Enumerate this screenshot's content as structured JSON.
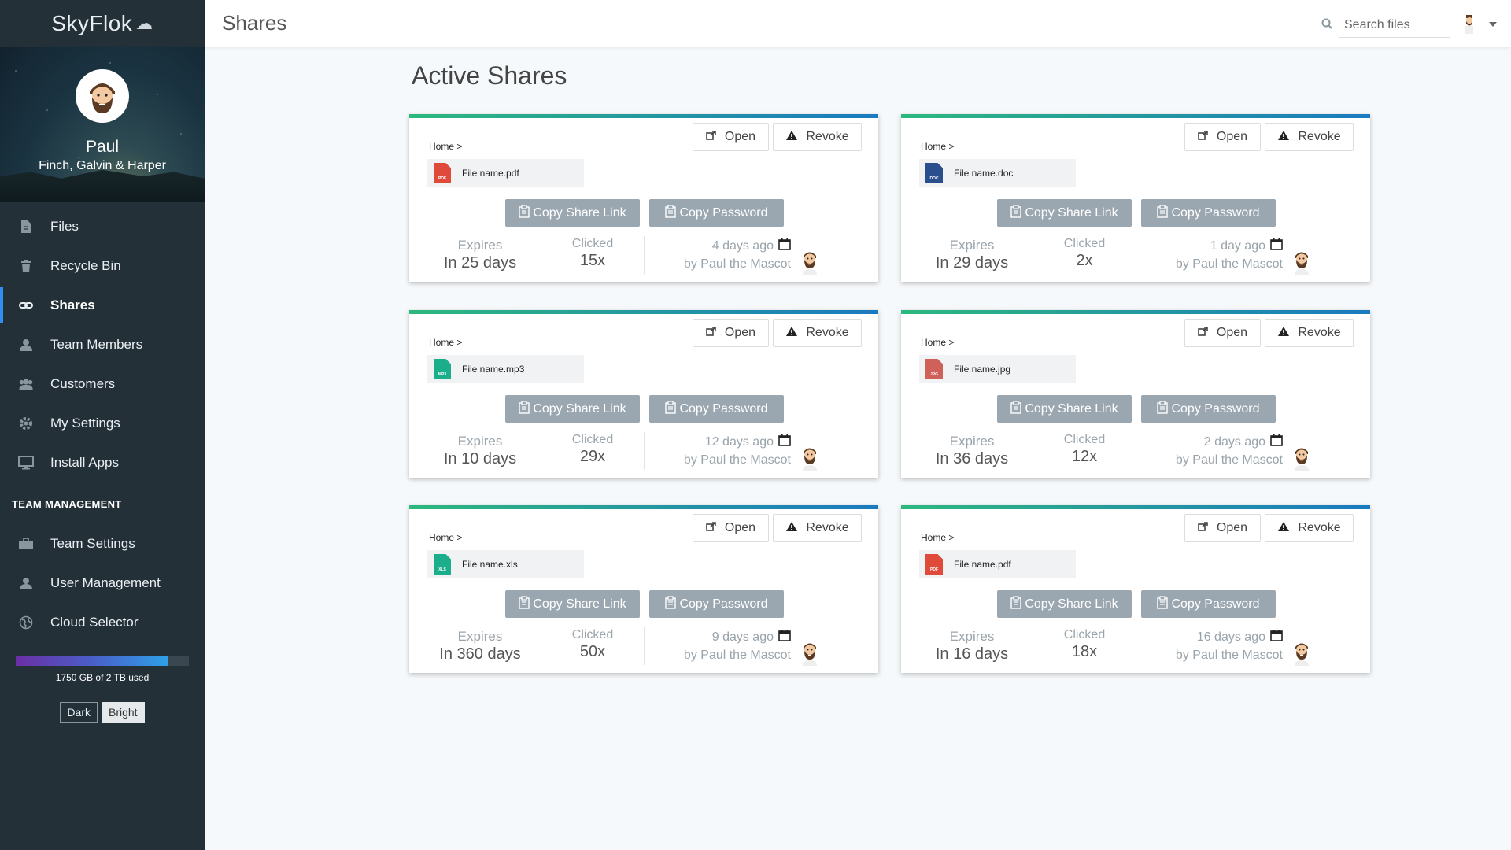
{
  "app": {
    "brand": "SkyFlok"
  },
  "profile": {
    "name": "Paul",
    "team": "Finch, Galvin & Harper"
  },
  "nav": {
    "items": [
      {
        "label": "Files",
        "icon": "file-icon"
      },
      {
        "label": "Recycle Bin",
        "icon": "trash-icon"
      },
      {
        "label": "Shares",
        "icon": "link-icon",
        "active": true
      },
      {
        "label": "Team Members",
        "icon": "user-icon"
      },
      {
        "label": "Customers",
        "icon": "users-icon"
      },
      {
        "label": "My Settings",
        "icon": "gear-icon"
      },
      {
        "label": "Install Apps",
        "icon": "monitor-icon"
      }
    ],
    "section_label": "TEAM MANAGEMENT",
    "team_items": [
      {
        "label": "Team Settings",
        "icon": "briefcase-icon"
      },
      {
        "label": "User Management",
        "icon": "user-icon"
      },
      {
        "label": "Cloud Selector",
        "icon": "globe-icon"
      }
    ]
  },
  "storage": {
    "text": "1750 GB of 2 TB used",
    "fraction": 0.875
  },
  "theme": {
    "dark_label": "Dark",
    "bright_label": "Bright",
    "selected": "Bright"
  },
  "topbar": {
    "title": "Shares",
    "search_placeholder": "Search files"
  },
  "main": {
    "title": "Active Shares"
  },
  "labels": {
    "breadcrumb": "Home >",
    "open": "Open",
    "revoke": "Revoke",
    "copy_link": "Copy Share Link",
    "copy_password": "Copy Password",
    "expires": "Expires",
    "clicked": "Clicked",
    "by": "by Paul the Mascot"
  },
  "colors": {
    "accent": "#2f8ef0",
    "card_gradient_start": "#2db87e",
    "card_gradient_end": "#1a7ac0"
  },
  "shares": [
    {
      "file": "File name.pdf",
      "type": "PDF",
      "color": "#e04a3a",
      "expires": "In 25 days",
      "clicked": "15x",
      "ago": "4 days ago"
    },
    {
      "file": "File name.doc",
      "type": "DOC",
      "color": "#2b4f8c",
      "expires": "In 29 days",
      "clicked": "2x",
      "ago": "1 day ago"
    },
    {
      "file": "File name.mp3",
      "type": "MP3",
      "color": "#1aae8a",
      "expires": "In 10 days",
      "clicked": "29x",
      "ago": "12 days ago"
    },
    {
      "file": "File name.jpg",
      "type": "JPG",
      "color": "#d0605a",
      "expires": "In 36 days",
      "clicked": "12x",
      "ago": "2 days ago"
    },
    {
      "file": "File name.xls",
      "type": "XLS",
      "color": "#1aae8a",
      "expires": "In 360 days",
      "clicked": "50x",
      "ago": "9 days ago"
    },
    {
      "file": "File name.pdf",
      "type": "PDF",
      "color": "#e04a3a",
      "expires": "In 16 days",
      "clicked": "18x",
      "ago": "16 days ago"
    }
  ]
}
